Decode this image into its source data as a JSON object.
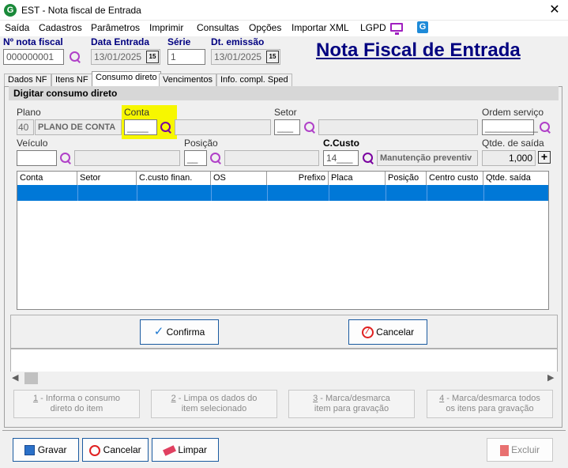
{
  "window": {
    "title": "EST - Nota fiscal de Entrada",
    "icon_letter": "G"
  },
  "menu": [
    "Saída",
    "Cadastros",
    "Parâmetros",
    "Imprimir",
    "Consultas",
    "Opções",
    "Importar XML",
    "LGPD"
  ],
  "header": {
    "nf_label": "Nº nota fiscal",
    "nf_value": "000000001",
    "entrada_label": "Data Entrada",
    "entrada_value": "13/01/2025",
    "serie_label": "Série",
    "serie_value": "1",
    "emissao_label": "Dt. emissão",
    "emissao_value": "13/01/2025",
    "calendar_glyph": "15",
    "big_title": "Nota Fiscal de Entrada"
  },
  "tabs": [
    "Dados NF",
    "Itens NF",
    "Consumo direto",
    "Vencimentos",
    "Info. compl. Sped"
  ],
  "group": {
    "title": "Digitar consumo direto"
  },
  "form": {
    "plano_label": "Plano",
    "plano_code": "40",
    "plano_desc": "PLANO DE CONTA",
    "conta_label": "Conta",
    "conta_value": "____",
    "setor_label": "Setor",
    "setor_value": "___",
    "ordem_label": "Ordem serviço",
    "ordem_value": "__________",
    "veiculo_label": "Veículo",
    "posicao_label": "Posição",
    "posicao_value": "__",
    "ccusto_label": "C.Custo",
    "ccusto_value": "14___",
    "ccusto_desc": "Manutenção preventiv",
    "qtde_label": "Qtde. de saída",
    "qtde_value": "1,000"
  },
  "grid": {
    "columns": [
      "Conta",
      "Setor",
      "C.custo finan.",
      "OS",
      "Prefixo",
      "Placa",
      "Posição",
      "Centro custo",
      "Qtde. saída"
    ]
  },
  "actions": {
    "confirma": "Confirma",
    "cancelar": "Cancelar"
  },
  "help_buttons": [
    {
      "num": "1",
      "line1": " - Informa o consumo",
      "line2": "direto do item"
    },
    {
      "num": "2",
      "line1": " - Limpa os dados do",
      "line2": "item selecionado"
    },
    {
      "num": "3",
      "line1": " - Marca/desmarca",
      "line2": "item para gravação"
    },
    {
      "num": "4",
      "line1": " - Marca/desmarca todos",
      "line2": "os itens para gravação"
    }
  ],
  "footer": {
    "gravar": "Gravar",
    "cancelar": "Cancelar",
    "limpar": "Limpar",
    "excluir": "Excluir"
  },
  "colors": {
    "accent_navy": "#000080",
    "selection_blue": "#0078d7",
    "highlight_yellow": "#f7f700",
    "icon_purple": "#b040c8"
  }
}
